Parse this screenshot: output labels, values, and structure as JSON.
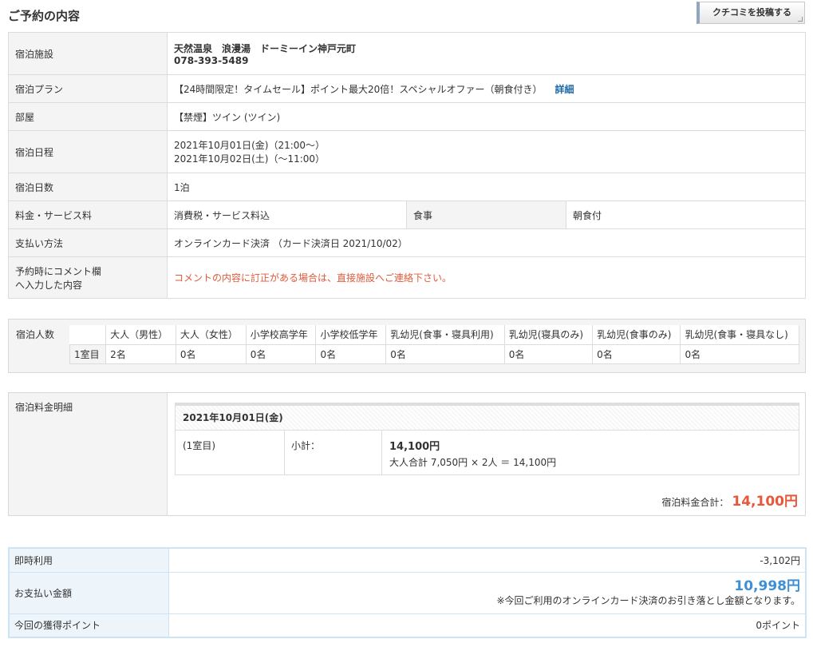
{
  "header": {
    "title": "ご予約の内容",
    "review_button": "クチコミを投稿する"
  },
  "info": {
    "facility_label": "宿泊施設",
    "facility_name": "天然温泉　浪漫湯　ドーミーイン神戸元町",
    "facility_tel": "078-393-5489",
    "plan_label": "宿泊プラン",
    "plan_text": "【24時間限定！タイムセール】ポイント最大20倍！スペシャルオファー（朝食付き）",
    "plan_detail_link": "詳細",
    "room_label": "部屋",
    "room_text": "【禁煙】ツイン (ツイン)",
    "schedule_label": "宿泊日程",
    "checkin": "2021年10月01日(金)（21:00〜）",
    "checkout": "2021年10月02日(土)（〜11:00）",
    "nights_label": "宿泊日数",
    "nights": "1泊",
    "fee_label": "料金・サービス料",
    "fee_text": "消費税・サービス料込",
    "meal_label": "食事",
    "meal_text": "朝食付",
    "payment_label": "支払い方法",
    "payment_text": "オンラインカード決済 （カード決済日 2021/10/02）",
    "comment_label_line1": "予約時にコメント欄",
    "comment_label_line2": "へ入力した内容",
    "comment_notice": "コメントの内容に訂正がある場合は、直接施設へご連絡下さい。"
  },
  "guests": {
    "label": "宿泊人数",
    "headers": [
      "大人（男性）",
      "大人（女性）",
      "小学校高学年",
      "小学校低学年",
      "乳幼児(食事・寝具利用)",
      "乳幼児(寝具のみ)",
      "乳幼児(食事のみ)",
      "乳幼児(食事・寝具なし)"
    ],
    "rows": [
      {
        "room": "1室目",
        "values": [
          "2名",
          "0名",
          "0名",
          "0名",
          "0名",
          "0名",
          "0名",
          "0名"
        ]
      }
    ]
  },
  "price": {
    "label": "宿泊料金明細",
    "date": "2021年10月01日(金)",
    "room": "(1室目)",
    "subtotal_label": "小計：",
    "subtotal_value": "14,100円",
    "breakdown": "大人合計 7,050円 × 2人 ＝ 14,100円",
    "total_label": "宿泊料金合計：",
    "total_value": "14,100円"
  },
  "payment": {
    "instant_label": "即時利用",
    "instant_value": "-3,102円",
    "amount_label": "お支払い金額",
    "amount_value": "10,998円",
    "amount_note": "※今回ご利用のオンラインカード決済のお引き落とし金額となります。",
    "points_label": "今回の獲得ポイント",
    "points_value": "0ポイント"
  }
}
